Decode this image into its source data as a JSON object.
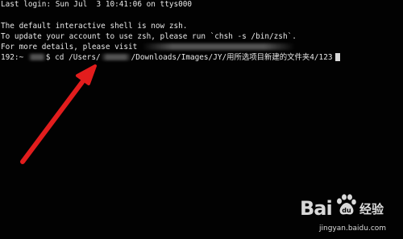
{
  "terminal": {
    "line1": "Last login: Sun Jul  3 10:41:06 on ttys000",
    "line2": "The default interactive shell is now zsh.",
    "line3": "To update your account to use zsh, please run `chsh -s /bin/zsh`.",
    "line4": "For more details, please visit ",
    "prompt_host": "192:~ ",
    "command_part1": "$ cd /Users/",
    "command_part2": "/Downloads/Images/JY/用所选项目新建的文件夹4/123"
  },
  "annotation": {
    "arrow_color": "#e21d1d"
  },
  "watermark": {
    "brand_left": "Bai",
    "brand_right": "百",
    "experience": "经验",
    "url": "jingyan.baidu.com"
  }
}
